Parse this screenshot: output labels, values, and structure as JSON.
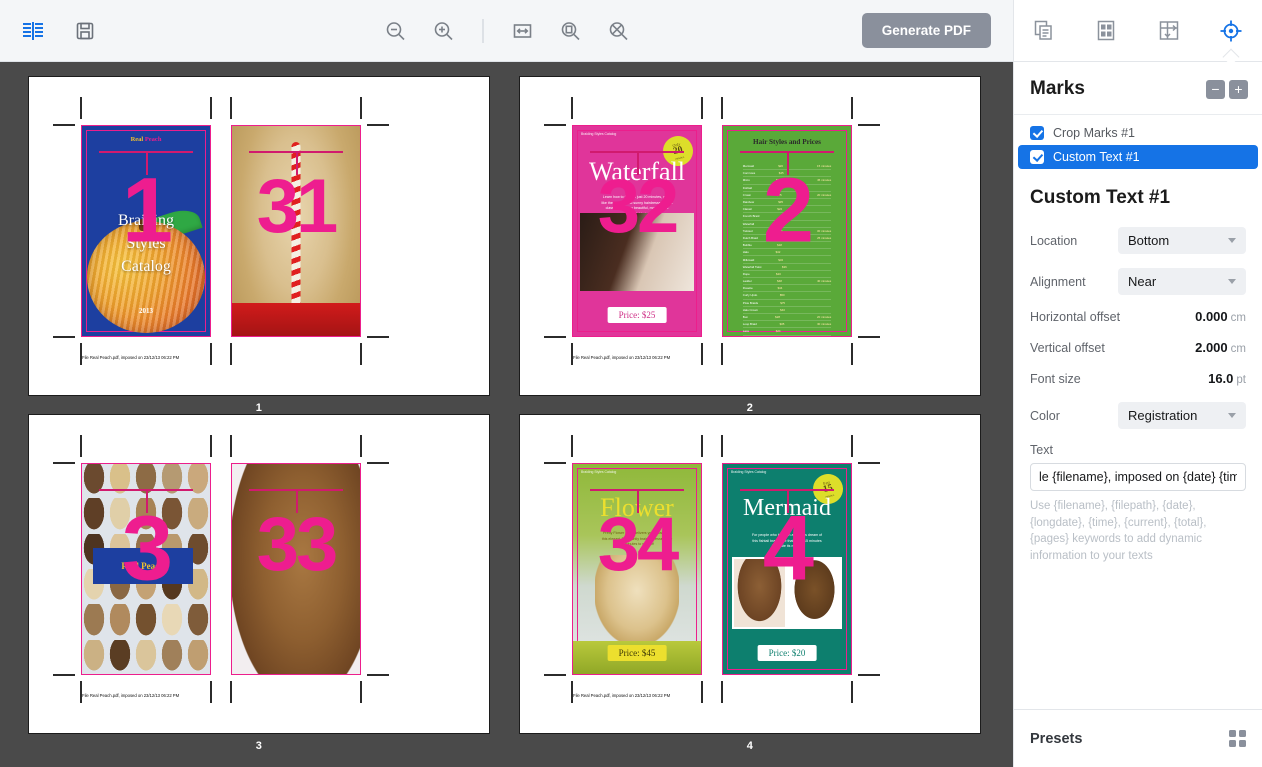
{
  "toolbar": {
    "left_tools": [
      {
        "name": "spread-view-icon",
        "label": "Spread View",
        "active": true
      },
      {
        "name": "save-icon",
        "label": "Save",
        "active": false
      }
    ],
    "zoom_tools": [
      {
        "name": "zoom-out-icon",
        "label": "Zoom Out"
      },
      {
        "name": "zoom-in-icon",
        "label": "Zoom In"
      },
      {
        "name": "fit-width-icon",
        "label": "Fit Width"
      },
      {
        "name": "actual-size-icon",
        "label": "Actual Size"
      },
      {
        "name": "fit-page-icon",
        "label": "Fit Page"
      }
    ],
    "generate_pdf_label": "Generate PDF"
  },
  "canvas": {
    "footer_text": "File Real Peach.pdf, imposed on 23/12/13 06:22 PM",
    "sheets": [
      {
        "label": "1",
        "pages": [
          {
            "slot": "1",
            "kind": "cover-blue",
            "brand_1": "Real",
            "brand_2": "Peach",
            "title_lines": [
              "Braiding",
              "Styles",
              "Catalog"
            ],
            "year": "2013"
          },
          {
            "slot": "31",
            "kind": "photo-blonde-braid"
          }
        ]
      },
      {
        "label": "2",
        "pages": [
          {
            "slot": "32",
            "kind": "cover-pink",
            "title": "Waterfall",
            "masthead": "Braiding Styles Catalog",
            "body": "Learn how to fall this just 20 minutes, you'll like the volume and sunny hairdresser of this classical braid so beautiful, modest and beautiful hair.",
            "price": "Price: $25",
            "badge": {
              "small": "Only",
              "number": "20",
              "minutes": "minutes"
            }
          },
          {
            "slot": "2",
            "kind": "price-list",
            "title": "Hair Styles and Prices"
          }
        ]
      },
      {
        "label": "3",
        "pages": [
          {
            "slot": "3",
            "kind": "contact-sheet",
            "banner_1": "Real",
            "banner_2": "Peach"
          },
          {
            "slot": "33",
            "kind": "photo-brown-waterfall"
          }
        ]
      },
      {
        "label": "4",
        "pages": [
          {
            "slot": "34",
            "kind": "cover-flower",
            "title": "Flower",
            "masthead": "Braiding Styles Catalog",
            "body": "Pretty Flower braid delivers your head with this elegant & elegantly braided tresses only 30 minutes to master!",
            "price": "Price: $45"
          },
          {
            "slot": "4",
            "kind": "cover-mermaid",
            "title": "Mermaid",
            "masthead": "Braiding Styles Catalog",
            "body": "For people who have an ambitious dream of this fishtail braid style that takes 15 minutes to create its magic.",
            "price": "Price: $20",
            "badge": {
              "small": "Fast",
              "number": "15",
              "minutes": "minutes"
            }
          }
        ]
      }
    ],
    "price_list": {
      "title": "Hair Styles and Prices",
      "rows": [
        {
          "name": "Mermaid",
          "value": "$20",
          "note": "15 minutes"
        },
        {
          "name": "Cornrows",
          "value": "$45",
          "note": ""
        },
        {
          "name": "Micro",
          "value": "$65",
          "note": "45 minutes"
        },
        {
          "name": "Fishtail",
          "value": "$30",
          "note": ""
        },
        {
          "name": "Crown",
          "value": "$25",
          "note": "20 minutes"
        },
        {
          "name": "Rainbow",
          "value": "$35",
          "note": ""
        },
        {
          "name": "Classic",
          "value": "$22",
          "note": ""
        },
        {
          "name": "French Braid",
          "value": "$28",
          "note": ""
        },
        {
          "name": "Waterfall",
          "value": "$25",
          "note": ""
        },
        {
          "name": "Twisted",
          "value": "$40",
          "note": "30 minutes"
        },
        {
          "name": "Dutch Braid",
          "value": "$38",
          "note": "25 minutes"
        },
        {
          "name": "Bubble",
          "value": "$18",
          "note": ""
        },
        {
          "name": "Halo",
          "value": "$42",
          "note": ""
        },
        {
          "name": "Milkmaid",
          "value": "$32",
          "note": ""
        },
        {
          "name": "Waterfall Twist",
          "value": "$36",
          "note": ""
        },
        {
          "name": "Rope",
          "value": "$20",
          "note": ""
        },
        {
          "name": "Ladder",
          "value": "$48",
          "note": "40 minutes"
        },
        {
          "name": "Rosette",
          "value": "$44",
          "note": ""
        },
        {
          "name": "Curly Updo",
          "value": "$50",
          "note": ""
        },
        {
          "name": "Pixie Braids",
          "value": "$75",
          "note": ""
        },
        {
          "name": "Halo Crown",
          "value": "$40",
          "note": ""
        },
        {
          "name": "Bun",
          "value": "$28",
          "note": "20 minutes"
        },
        {
          "name": "Loop Braid",
          "value": "$35",
          "note": "30 minutes"
        },
        {
          "name": "Lace",
          "value": "$24",
          "note": ""
        },
        {
          "name": "Fingerwave",
          "value": "$52",
          "note": "45 minutes"
        },
        {
          "name": "Snake",
          "value": "$30",
          "note": "25 minutes"
        },
        {
          "name": "Ribbon",
          "value": "$26",
          "note": ""
        }
      ]
    }
  },
  "panel": {
    "tabs": [
      {
        "name": "pages-tab",
        "label": "Pages",
        "active": false
      },
      {
        "name": "layout-tab",
        "label": "Layout",
        "active": false
      },
      {
        "name": "binding-tab",
        "label": "Binding",
        "active": false
      },
      {
        "name": "marks-tab",
        "label": "Marks",
        "active": true
      }
    ],
    "marks": {
      "header": "Marks",
      "remove_label": "−",
      "add_label": "+",
      "items": [
        {
          "label": "Crop Marks #1",
          "checked": true,
          "selected": false
        },
        {
          "label": "Custom Text #1",
          "checked": true,
          "selected": true
        }
      ]
    },
    "properties": {
      "title": "Custom Text #1",
      "location_label": "Location",
      "location_value": "Bottom",
      "alignment_label": "Alignment",
      "alignment_value": "Near",
      "horizontal_offset_label": "Horizontal offset",
      "horizontal_offset_value": "0.000",
      "horizontal_offset_unit": "cm",
      "vertical_offset_label": "Vertical offset",
      "vertical_offset_value": "2.000",
      "vertical_offset_unit": "cm",
      "font_size_label": "Font size",
      "font_size_value": "16.0",
      "font_size_unit": "pt",
      "color_label": "Color",
      "color_value": "Registration",
      "text_label": "Text",
      "text_value": "le {filename}, imposed on {date} {time}",
      "text_hint": "Use {filename}, {filepath}, {date}, {longdate}, {time}, {current}, {total}, {pages} keywords to add dynamic information to your texts"
    },
    "presets": {
      "title": "Presets",
      "grid_icon": "grid-icon"
    }
  },
  "colors": {
    "accent_blue": "#1573e6",
    "magenta": "#ee1d8f",
    "toolbar_bg": "#f4f6f8",
    "canvas_bg": "#4a4a4a",
    "button_gray": "#8a909c"
  }
}
